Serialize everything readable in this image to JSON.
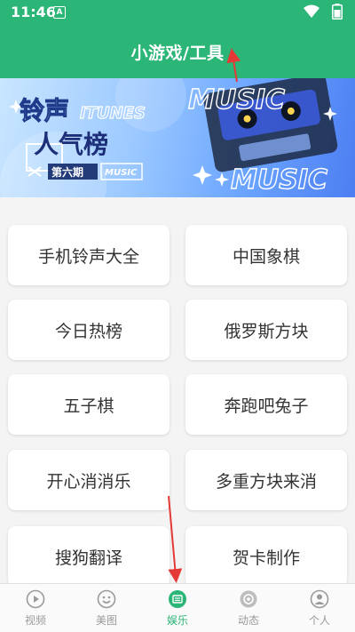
{
  "status": {
    "time": "11:46",
    "notif_letter": "A"
  },
  "header": {
    "title": "小游戏/工具"
  },
  "banner": {
    "title_line1": "铃声",
    "title_line2": "人气榜",
    "overlay_word": "ITUNES",
    "issue": "第六期",
    "music_tag": "MUSIC",
    "music_big": "MUSIC"
  },
  "tiles": [
    "手机铃声大全",
    "中国象棋",
    "今日热榜",
    "俄罗斯方块",
    "五子棋",
    "奔跑吧兔子",
    "开心消消乐",
    "多重方块来消",
    "搜狗翻译",
    "贺卡制作"
  ],
  "tabs": [
    {
      "label": "视频",
      "icon": "play-circle-icon"
    },
    {
      "label": "美图",
      "icon": "smiley-icon"
    },
    {
      "label": "娱乐",
      "icon": "list-icon"
    },
    {
      "label": "动态",
      "icon": "camera-aperture-icon"
    },
    {
      "label": "个人",
      "icon": "person-icon"
    }
  ],
  "colors": {
    "accent": "#2bb577",
    "annotation": "#e53935"
  }
}
